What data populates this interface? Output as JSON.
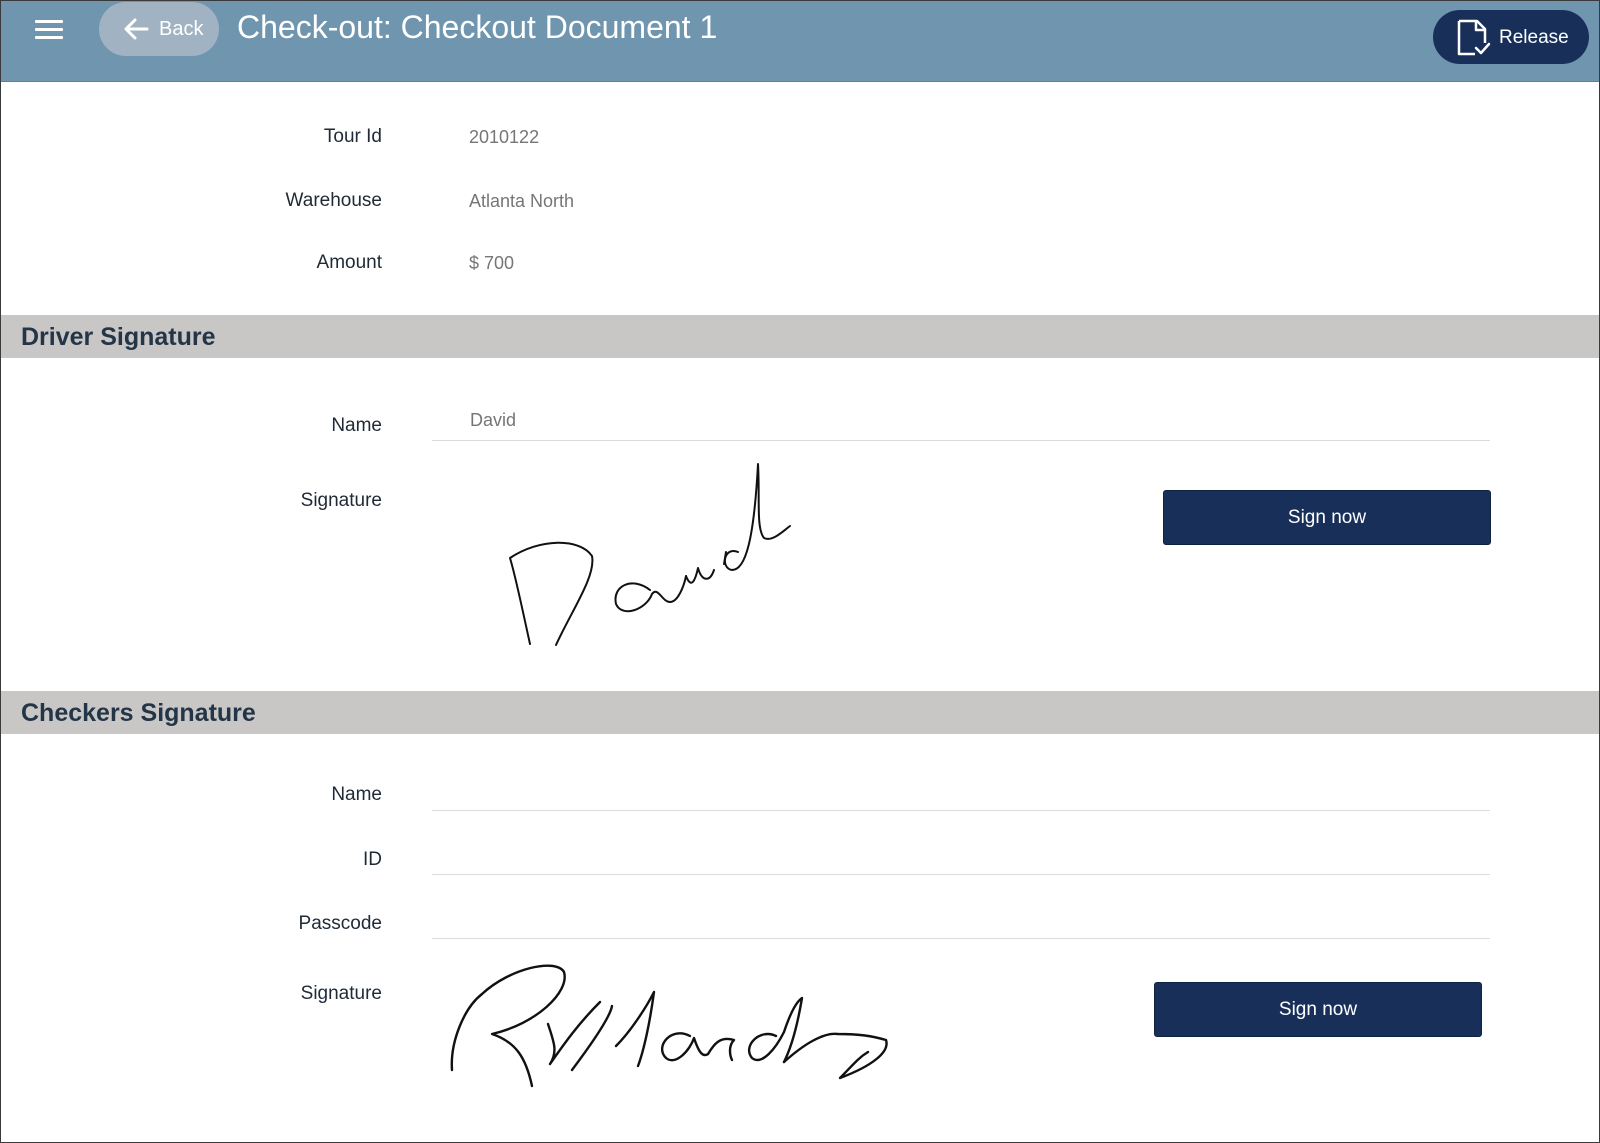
{
  "header": {
    "title": "Check-out: Checkout Document 1",
    "back_label": "Back",
    "release_label": "Release"
  },
  "details": {
    "tour_id_label": "Tour Id",
    "tour_id_value": "2010122",
    "warehouse_label": "Warehouse",
    "warehouse_value": "Atlanta North",
    "amount_label": "Amount",
    "amount_value": "$ 700"
  },
  "driver": {
    "section_title": "Driver Signature",
    "name_label": "Name",
    "name_value": "David",
    "signature_label": "Signature",
    "sign_button": "Sign now"
  },
  "checkers": {
    "section_title": "Checkers Signature",
    "name_label": "Name",
    "name_value": "",
    "id_label": "ID",
    "id_value": "",
    "passcode_label": "Passcode",
    "passcode_value": "",
    "signature_label": "Signature",
    "sign_button": "Sign now"
  },
  "colors": {
    "header_bg": "#7096af",
    "primary_button": "#183059",
    "section_bg": "#c8c7c5"
  },
  "icons": {
    "menu": "hamburger-icon",
    "back": "arrow-left-icon",
    "release": "document-check-icon"
  }
}
